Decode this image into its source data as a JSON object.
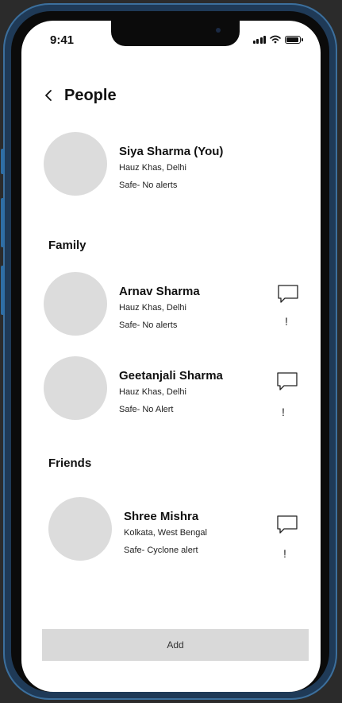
{
  "status_bar": {
    "time": "9:41"
  },
  "header": {
    "title": "People"
  },
  "self": {
    "name": "Siya Sharma (You)",
    "location": "Hauz Khas, Delhi",
    "status": "Safe- No alerts"
  },
  "sections": {
    "family": {
      "title": "Family",
      "members": [
        {
          "name": "Arnav Sharma",
          "location": "Hauz Khas, Delhi",
          "status": "Safe- No alerts",
          "alert_mark": "!"
        },
        {
          "name": "Geetanjali Sharma",
          "location": "Hauz Khas, Delhi",
          "status": "Safe- No Alert",
          "alert_mark": "!"
        }
      ]
    },
    "friends": {
      "title": "Friends",
      "members": [
        {
          "name": "Shree Mishra",
          "location": "Kolkata, West Bengal",
          "status": "Safe- Cyclone alert",
          "alert_mark": "!"
        }
      ]
    }
  },
  "footer": {
    "add_label": "Add"
  },
  "icons": {
    "back": "chevron-left-icon",
    "chat": "chat-bubble-icon",
    "signal": "signal-icon",
    "wifi": "wifi-icon",
    "battery": "battery-icon"
  },
  "colors": {
    "avatar": "#dcdcdc",
    "add_button": "#d9d9d9",
    "frame": "#2f6ea5"
  }
}
